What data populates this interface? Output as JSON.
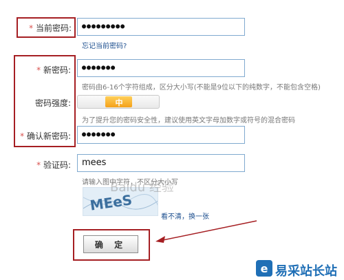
{
  "form": {
    "current_password": {
      "star": "*",
      "label": "当前密码:",
      "value": "●●●●●●●●●",
      "forgot_link": "忘记当前密码?"
    },
    "new_password": {
      "star": "*",
      "label": "新密码:",
      "value": "●●●●●●●",
      "hint": "密码由6-16个字符组成，区分大小写(不能是9位以下的纯数字，不能包含空格)"
    },
    "strength": {
      "label": "密码强度:",
      "level_text": "中",
      "level_fraction": 0.5,
      "hint": "为了提升您的密码安全性，建议使用英文字母加数字或符号的混合密码"
    },
    "confirm_password": {
      "star": "*",
      "label": "确认新密码:",
      "value": "●●●●●●●"
    },
    "captcha": {
      "star": "*",
      "label": "验证码:",
      "value": "mees",
      "hint": "请输入图中字符，不区分大小写",
      "image_text": "MEeS",
      "refresh_link": "看不清，换一张"
    },
    "submit_label": "确 定"
  },
  "watermark": {
    "text": "Baidu 经验"
  },
  "branding": {
    "logo_text": "易采站长站"
  },
  "colors": {
    "highlight_box": "#a51e22",
    "input_border": "#7fa9cf",
    "link": "#1d4f8f",
    "strength_fill": "#f4a11a",
    "logo": "#1f6fb6"
  }
}
